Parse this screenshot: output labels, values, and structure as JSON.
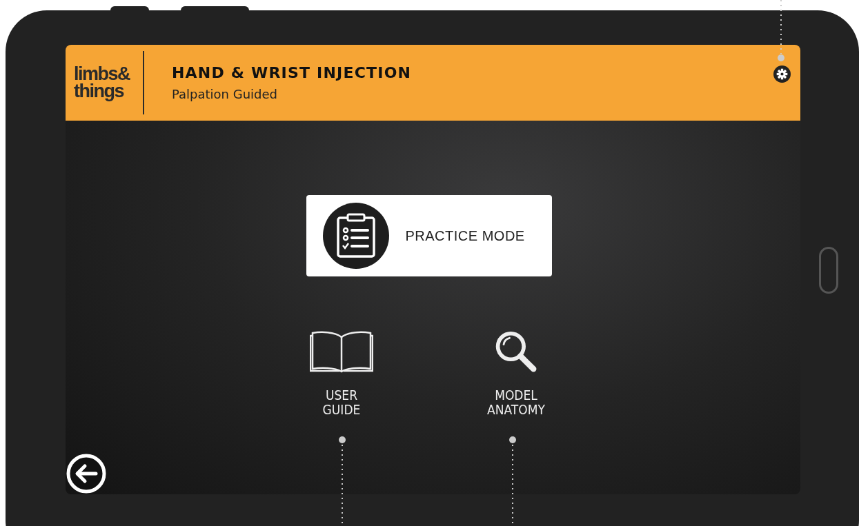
{
  "header": {
    "logo": [
      "limbs&",
      "things"
    ],
    "title": "HAND & WRIST INJECTION",
    "subtitle": "Palpation Guided"
  },
  "primary_button": {
    "label": "PRACTICE MODE"
  },
  "menu_items": [
    {
      "kind": "book",
      "label": [
        "USER",
        "GUIDE"
      ]
    },
    {
      "kind": "magnifier",
      "label": [
        "MODEL",
        "ANATOMY"
      ]
    }
  ]
}
